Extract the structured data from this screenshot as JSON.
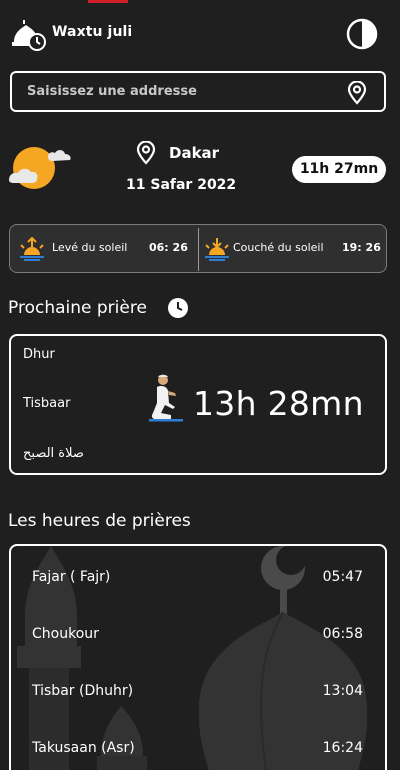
{
  "app": {
    "title": "Waxtu juli"
  },
  "search": {
    "placeholder": "Saisissez une addresse"
  },
  "location": {
    "city": "Dakar",
    "date": "11 Safar 2022",
    "time": "11h 27mn"
  },
  "sun": {
    "sunrise_label": "Levé du soleil",
    "sunrise_time": "06: 26",
    "sunset_label": "Couché du soleil",
    "sunset_time": "19: 26"
  },
  "next_prayer": {
    "section_title": "Prochaine prière",
    "name_fr": "Dhur",
    "name_wo": "Tisbaar",
    "name_ar": "صلاة الصبح",
    "countdown": "13h 28mn"
  },
  "prayer_times": {
    "section_title": "Les heures de prières",
    "items": [
      {
        "name": "Fajar ( Fajr)",
        "time": "05:47"
      },
      {
        "name": "Choukour",
        "time": "06:58"
      },
      {
        "name": "Tisbar (Dhuhr)",
        "time": "13:04"
      },
      {
        "name": "Takusaan (Asr)",
        "time": "16:24"
      }
    ]
  },
  "icons": {
    "logo": "mosque-clock-icon",
    "theme": "contrast-icon",
    "search": "location-pin-icon",
    "weather": "sun-cloud-icon",
    "sunrise": "sunrise-icon",
    "sunset": "sunset-icon",
    "clock": "clock-icon",
    "prayer": "praying-man-icon"
  },
  "colors": {
    "background": "#1f1f1f",
    "card": "#2f2f2f",
    "accent_sun": "#f5a623",
    "accent_red": "#d11f2a",
    "sunrise_blue": "#2d7fd3"
  }
}
